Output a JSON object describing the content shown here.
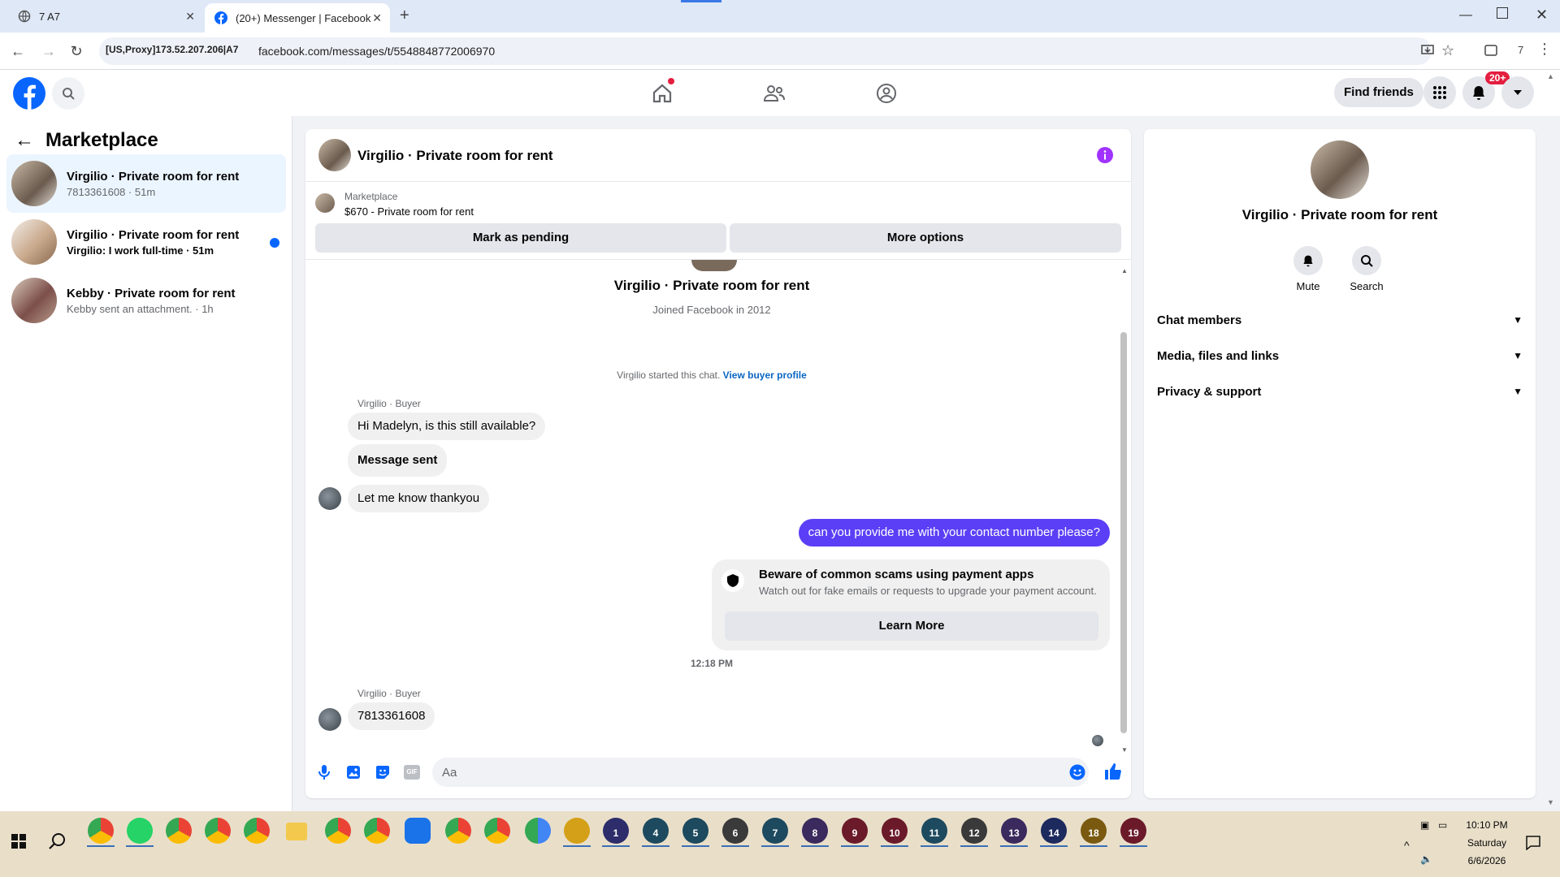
{
  "browser": {
    "tabs": [
      {
        "title": "7 A7",
        "icon": "globe-icon"
      },
      {
        "title": "(20+) Messenger | Facebook",
        "icon": "facebook-icon"
      }
    ],
    "proxy_label": "[US,Proxy]173.52.207.206|A7",
    "url": "facebook.com/messages/t/5548848772006970",
    "profile_count": "7"
  },
  "fb_header": {
    "find_friends": "Find friends",
    "notification_badge": "20+"
  },
  "left_panel": {
    "title": "Marketplace",
    "conversations": [
      {
        "name": "Virgilio · Private room for rent",
        "preview": "7813361608 · 51m",
        "selected": true,
        "unread": false
      },
      {
        "name": "Virgilio · Private room for rent",
        "preview": "Virgilio: I work full-time · 51m",
        "selected": false,
        "unread": true
      },
      {
        "name": "Kebby · Private room for rent",
        "preview": "Kebby sent an attachment. · 1h",
        "selected": false,
        "unread": false
      }
    ]
  },
  "chat": {
    "title": "Virgilio · Private room for rent",
    "listing_source": "Marketplace",
    "listing_desc": "$670 - Private room for rent",
    "mark_pending": "Mark as pending",
    "more_options": "More options",
    "profile_name": "Virgilio · Private room for rent",
    "joined": "Joined Facebook in 2012",
    "started_text": "Virgilio started this chat.",
    "view_buyer_profile": "View buyer profile",
    "sender_label_1": "Virgilio · Buyer",
    "msg1": "Hi Madelyn, is this still available?",
    "msg2": "Message sent",
    "msg3": "Let me know thankyou",
    "outgoing": "can you provide me with your contact number please?",
    "scam_title": "Beware of common scams using payment apps",
    "scam_desc": "Watch out for fake emails or requests to upgrade your payment account.",
    "learn_more": "Learn More",
    "timestamp": "12:18 PM",
    "sender_label_2": "Virgilio · Buyer",
    "msg4": "7813361608",
    "composer_placeholder": "Aa"
  },
  "right_panel": {
    "name": "Virgilio · Private room for rent",
    "mute": "Mute",
    "search": "Search",
    "sections": [
      "Chat members",
      "Media, files and links",
      "Privacy & support"
    ]
  },
  "taskbar": {
    "time": "10:10 PM",
    "day": "Saturday",
    "date": "6/6/2026",
    "numbered_apps": [
      "1",
      "4",
      "5",
      "6",
      "7",
      "8",
      "9",
      "10",
      "11",
      "12",
      "13",
      "14",
      "18",
      "19"
    ]
  },
  "colors": {
    "fb_blue": "#0866ff",
    "messenger_purple": "#6f2fe3",
    "outgoing_bubble": "#5b3ff6",
    "unread_dot": "#0866ff"
  }
}
